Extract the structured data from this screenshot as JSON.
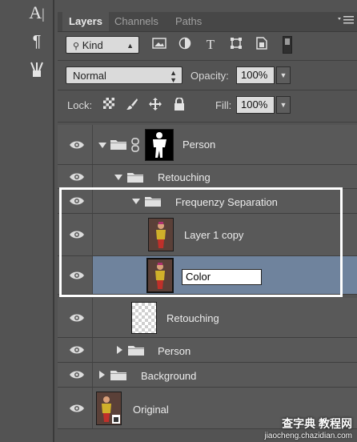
{
  "tools": [
    {
      "name": "type-tool-icon",
      "glyph": "A|"
    },
    {
      "name": "paragraph-icon",
      "glyph": "¶"
    },
    {
      "name": "brushes-icon",
      "glyph": "⚱"
    }
  ],
  "tabs": {
    "layers": "Layers",
    "channels": "Channels",
    "paths": "Paths"
  },
  "filter": {
    "kind": "Kind"
  },
  "blend": {
    "mode": "Normal",
    "opacity_label": "Opacity:",
    "opacity_value": "100%"
  },
  "lock": {
    "label": "Lock:",
    "fill_label": "Fill:",
    "fill_value": "100%"
  },
  "layers": [
    {
      "name": "Person"
    },
    {
      "name": "Retouching"
    },
    {
      "name": "Frequenzy Separation"
    },
    {
      "name": "Layer 1 copy"
    },
    {
      "name": "Color"
    },
    {
      "name": "Retouching"
    },
    {
      "name": "Person"
    },
    {
      "name": "Background"
    },
    {
      "name": "Original"
    }
  ],
  "watermark": {
    "line1": "查字典 教程网",
    "line2": "jiaocheng.chazidian.com"
  },
  "colors": {
    "selected_row": "#6f839d",
    "highlight_border": "#ffffff"
  }
}
